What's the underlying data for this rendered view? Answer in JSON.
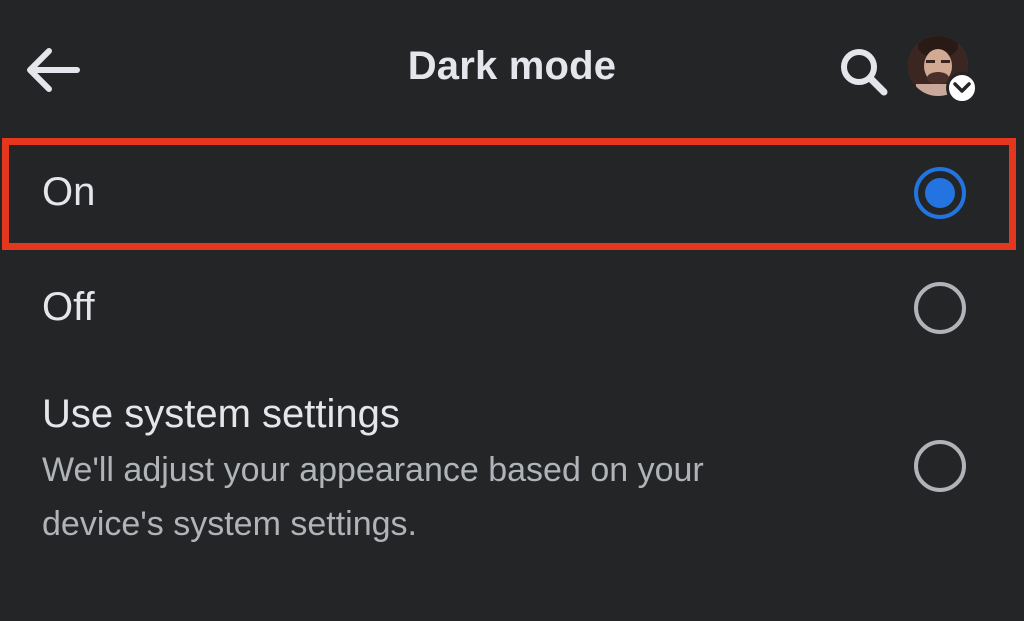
{
  "header": {
    "title": "Dark mode",
    "back_icon": "arrow-left-icon",
    "search_icon": "search-icon",
    "avatar_badge_icon": "chevron-down-icon"
  },
  "options": [
    {
      "label": "On",
      "selected": true
    },
    {
      "label": "Off",
      "selected": false
    },
    {
      "label": "Use system settings",
      "description_line1": "We'll adjust your appearance based on your",
      "description_line2": "device's system settings.",
      "selected": false
    }
  ],
  "colors": {
    "background": "#242526",
    "text_primary": "#e4e6eb",
    "text_secondary": "#b0b3b8",
    "accent_blue": "#2374e1",
    "highlight_red": "#e5371d"
  }
}
